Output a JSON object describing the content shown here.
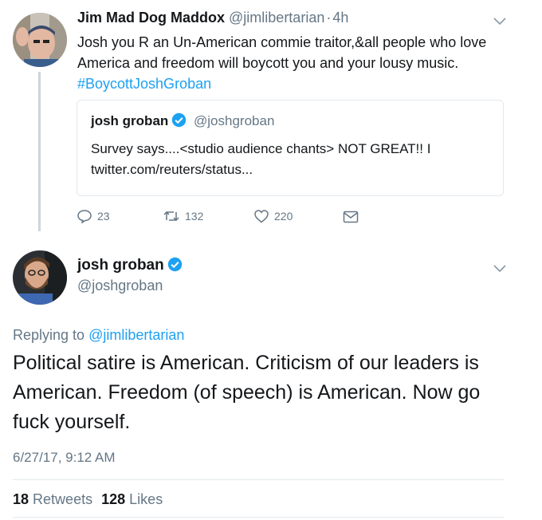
{
  "reply_tweet": {
    "display_name": "Jim Mad Dog Maddox",
    "handle": "@jimlibertarian",
    "separator": "·",
    "time": "4h",
    "text": "Josh you R an Un-American commie traitor,&all people who love America and freedom will boycott you and your lousy music.",
    "hashtag": "#BoycottJoshGroban",
    "quoted": {
      "display_name": "josh groban",
      "handle": "@joshgroban",
      "text": "Survey says....<studio audience chants> NOT GREAT!! I twitter.com/reuters/status..."
    },
    "actions": {
      "replies": "23",
      "retweets": "132",
      "likes": "220"
    }
  },
  "main_tweet": {
    "display_name": "josh groban",
    "handle": "@joshgroban",
    "replying_prefix": "Replying to",
    "replying_to": "@jimlibertarian",
    "text": "Political satire is American. Criticism of our leaders is American. Freedom (of speech) is American. Now go fuck yourself.",
    "timestamp": "6/27/17, 9:12 AM",
    "retweets_count": "18",
    "retweets_label": "Retweets",
    "likes_count": "128",
    "likes_label": "Likes"
  },
  "colors": {
    "link": "#1da1f2",
    "muted": "#657786",
    "border": "#e1e8ed"
  },
  "icons": [
    "chevron-down-icon",
    "verified-badge-icon",
    "reply-icon",
    "retweet-icon",
    "like-icon",
    "direct-message-icon"
  ]
}
